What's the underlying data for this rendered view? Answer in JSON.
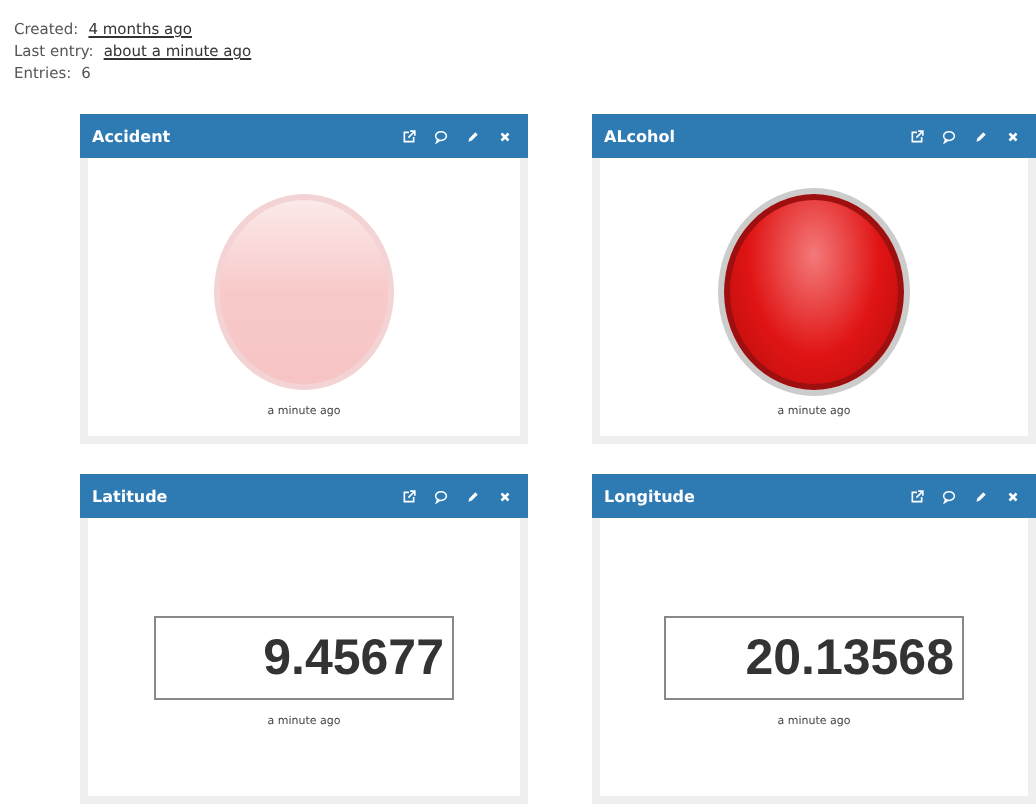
{
  "info": [
    {
      "label": "Created:",
      "value": "4 months ago",
      "link": true
    },
    {
      "label": "Last entry:",
      "value": "about a minute ago",
      "link": true
    },
    {
      "label": "Entries:",
      "value": "6",
      "link": false
    }
  ],
  "widgets": [
    {
      "title": "Accident",
      "kind": "led",
      "on": false,
      "updated": "a minute ago"
    },
    {
      "title": "ALcohol",
      "kind": "led",
      "on": true,
      "updated": "a minute ago"
    },
    {
      "title": "Latitude",
      "kind": "value",
      "value": "9.45677",
      "updated": "a minute ago"
    },
    {
      "title": "Longitude",
      "kind": "value",
      "value": "20.13568",
      "updated": "a minute ago"
    }
  ]
}
